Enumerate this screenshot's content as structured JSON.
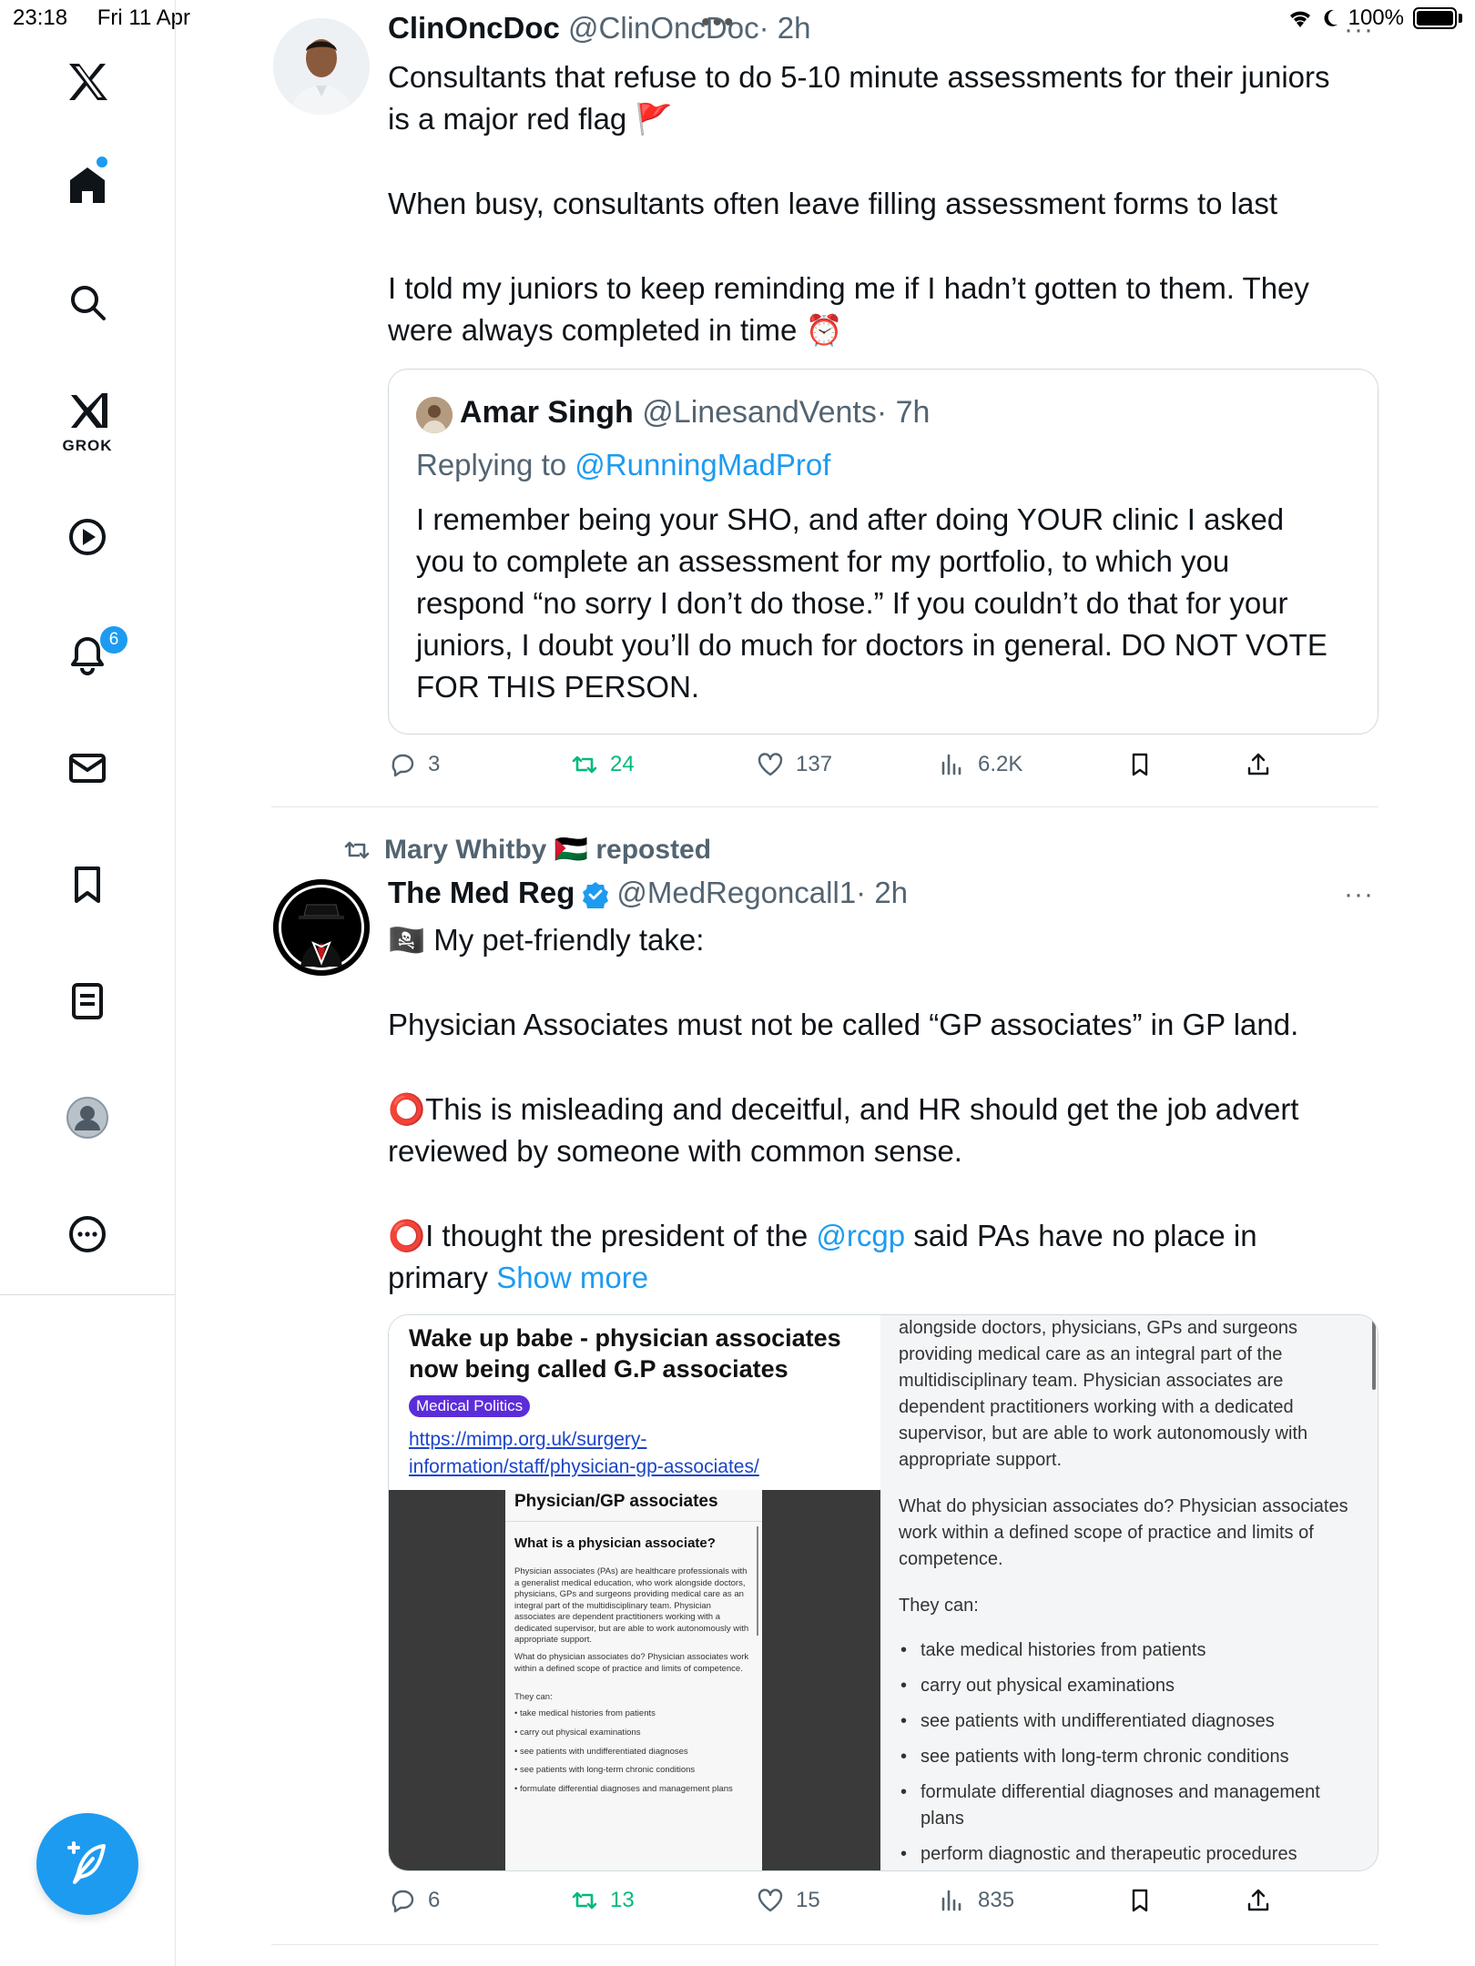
{
  "status_bar": {
    "time": "23:18",
    "date": "Fri 11 Apr",
    "battery": "100%"
  },
  "sidebar": {
    "grok_label": "GROK",
    "notifications_count": "6",
    "items": [
      "x-logo",
      "home",
      "explore",
      "grok",
      "video",
      "notifications",
      "messages",
      "bookmarks",
      "lists",
      "profile",
      "more"
    ]
  },
  "tweet1": {
    "name": "ClinOncDoc",
    "handle": "@ClinOncDoc",
    "time": "· 2h",
    "lines": [
      "Consultants that refuse to do 5-10 minute assessments for their juniors",
      "is a major red flag 🚩",
      "When busy, consultants often leave filling assessment forms to last",
      "I told my juniors to keep reminding me if I hadn’t gotten to them. They",
      "were always completed in time ⏰"
    ],
    "quote": {
      "name": "Amar Singh",
      "handle": "@LinesandVents",
      "time": "· 7h",
      "replying_prefix": "Replying to ",
      "replying_to": "@RunningMadProf",
      "lines": [
        "I remember being your SHO, and after doing YOUR clinic I asked",
        "you to complete an assessment for my portfolio, to which you",
        "respond “no sorry I don’t do those.” If you couldn’t do that for your",
        "juniors, I doubt you’ll do much for doctors in general. DO NOT VOTE",
        "FOR THIS PERSON."
      ]
    },
    "actions": {
      "replies": "3",
      "reposts": "24",
      "likes": "137",
      "views": "6.2K"
    }
  },
  "tweet2": {
    "reposted_by": "Mary Whitby 🇵🇸 reposted",
    "name": "The Med Reg",
    "handle": "@MedRegoncall1",
    "time": "· 2h",
    "lines": [
      "🏴‍☠️ My pet-friendly take:",
      "Physician Associates must not be called “GP associates” in GP land.",
      "⭕This is misleading and deceitful, and HR should get the job advert",
      "reviewed by someone with common sense.",
      "⭕I thought the president of the "
    ],
    "mention": "@rcgp",
    "line5_suffix": " said PAs have no place in",
    "line6_prefix": "primary ",
    "show_more": "Show more",
    "media": {
      "title": "Wake up babe - physician associates now being called G.P associates",
      "tag": "Medical Politics",
      "url": "https://mimp.org.uk/surgery-information/staff/physician-gp-associates/",
      "doc_title": "Physician/GP associates",
      "doc_heading": "What is a physician associate?",
      "doc_para1": "Physician associates (PAs) are healthcare professionals with a generalist medical education, who work alongside doctors, physicians, GPs and surgeons providing medical care as an integral part of the multidisciplinary team. Physician associates are dependent practitioners working with a dedicated supervisor, but are able to work autonomously with appropriate support.",
      "doc_para2": "What do physician associates do? Physician associates work within a defined scope of practice and limits of competence.",
      "doc_they_can": "They can:",
      "doc_list": [
        "take medical histories from patients",
        "carry out physical examinations",
        "see patients with undifferentiated diagnoses",
        "see patients with long-term chronic conditions",
        "formulate differential diagnoses and management plans"
      ],
      "right_para1": "alongside doctors, physicians, GPs and surgeons providing medical care as an integral part of the multidisciplinary team. Physician associates are dependent practitioners working with a dedicated supervisor, but are able to work autonomously with appropriate support.",
      "right_para2": "What do physician associates do? Physician associates work within a defined scope of practice and limits of competence.",
      "right_they_can": "They can:",
      "right_list": [
        "take medical histories from patients",
        "carry out physical examinations",
        "see patients with undifferentiated diagnoses",
        "see patients with long-term chronic conditions",
        "formulate differential diagnoses and management plans",
        "perform diagnostic and therapeutic procedures"
      ]
    },
    "actions": {
      "replies": "6",
      "reposts": "13",
      "likes": "15",
      "views": "835"
    }
  },
  "colors": {
    "accent": "#1d9bf0",
    "repost_green": "#00ba7c",
    "secondary_text": "#536471"
  }
}
